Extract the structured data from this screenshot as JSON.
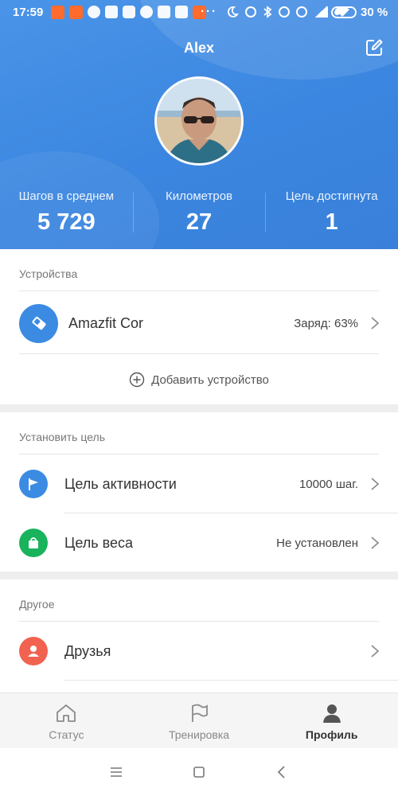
{
  "status_bar": {
    "time": "17:59",
    "battery_percent": "30 %",
    "battery_level": 0.3,
    "dots": "···"
  },
  "header": {
    "user_name": "Alex",
    "edit_icon": "edit-icon",
    "stats": [
      {
        "label": "Шагов в среднем",
        "value": "5 729"
      },
      {
        "label": "Километров",
        "value": "27"
      },
      {
        "label": "Цель достигнута",
        "value": "1"
      }
    ]
  },
  "devices": {
    "title": "Устройства",
    "device_name": "Amazfit Cor",
    "device_status": "Заряд: 63%",
    "add_device": "Добавить устройство"
  },
  "goals": {
    "title": "Установить цель",
    "items": [
      {
        "label": "Цель активности",
        "value": "10000 шаг.",
        "icon": "flag-icon",
        "color": "#3b8be3"
      },
      {
        "label": "Цель веса",
        "value": "Не установлен",
        "icon": "scale-icon",
        "color": "#19b35c"
      }
    ]
  },
  "other": {
    "title": "Другое",
    "items": [
      {
        "label": "Друзья",
        "icon": "friends-icon",
        "color": "#f26250"
      }
    ]
  },
  "bottom_nav": {
    "items": [
      {
        "label": "Статус",
        "icon": "home-icon"
      },
      {
        "label": "Тренировка",
        "icon": "flag-outline-icon"
      },
      {
        "label": "Профиль",
        "icon": "profile-icon",
        "active": true
      }
    ]
  },
  "colors": {
    "header_blue": "#3b86e0",
    "accent_blue": "#3b8be3",
    "green": "#19b35c",
    "red": "#f26250"
  }
}
